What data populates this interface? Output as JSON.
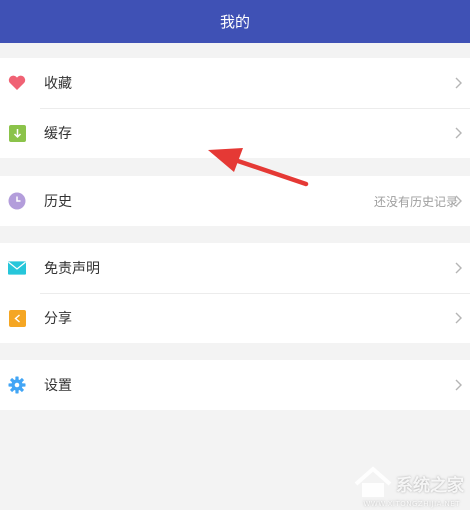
{
  "header": {
    "title": "我的"
  },
  "menu": {
    "favorites": {
      "label": "收藏",
      "icon": "heart-icon",
      "color": "#f06274"
    },
    "cache": {
      "label": "缓存",
      "icon": "download-icon",
      "color": "#8bc34a"
    },
    "history": {
      "label": "历史",
      "icon": "clock-icon",
      "color": "#b39ddb",
      "hint": "还没有历史记录"
    },
    "disclaimer": {
      "label": "免责声明",
      "icon": "envelope-icon",
      "color": "#26c6da"
    },
    "share": {
      "label": "分享",
      "icon": "share-icon",
      "color": "#f5a623"
    },
    "settings": {
      "label": "设置",
      "icon": "gear-icon",
      "color": "#42a5f5"
    }
  },
  "theme": {
    "accent": "#3f51b5",
    "annotation_arrow": "#e53935"
  },
  "watermark": {
    "text": "系统之家",
    "sub": "WWW.XITONGZHIJIA.NET"
  }
}
